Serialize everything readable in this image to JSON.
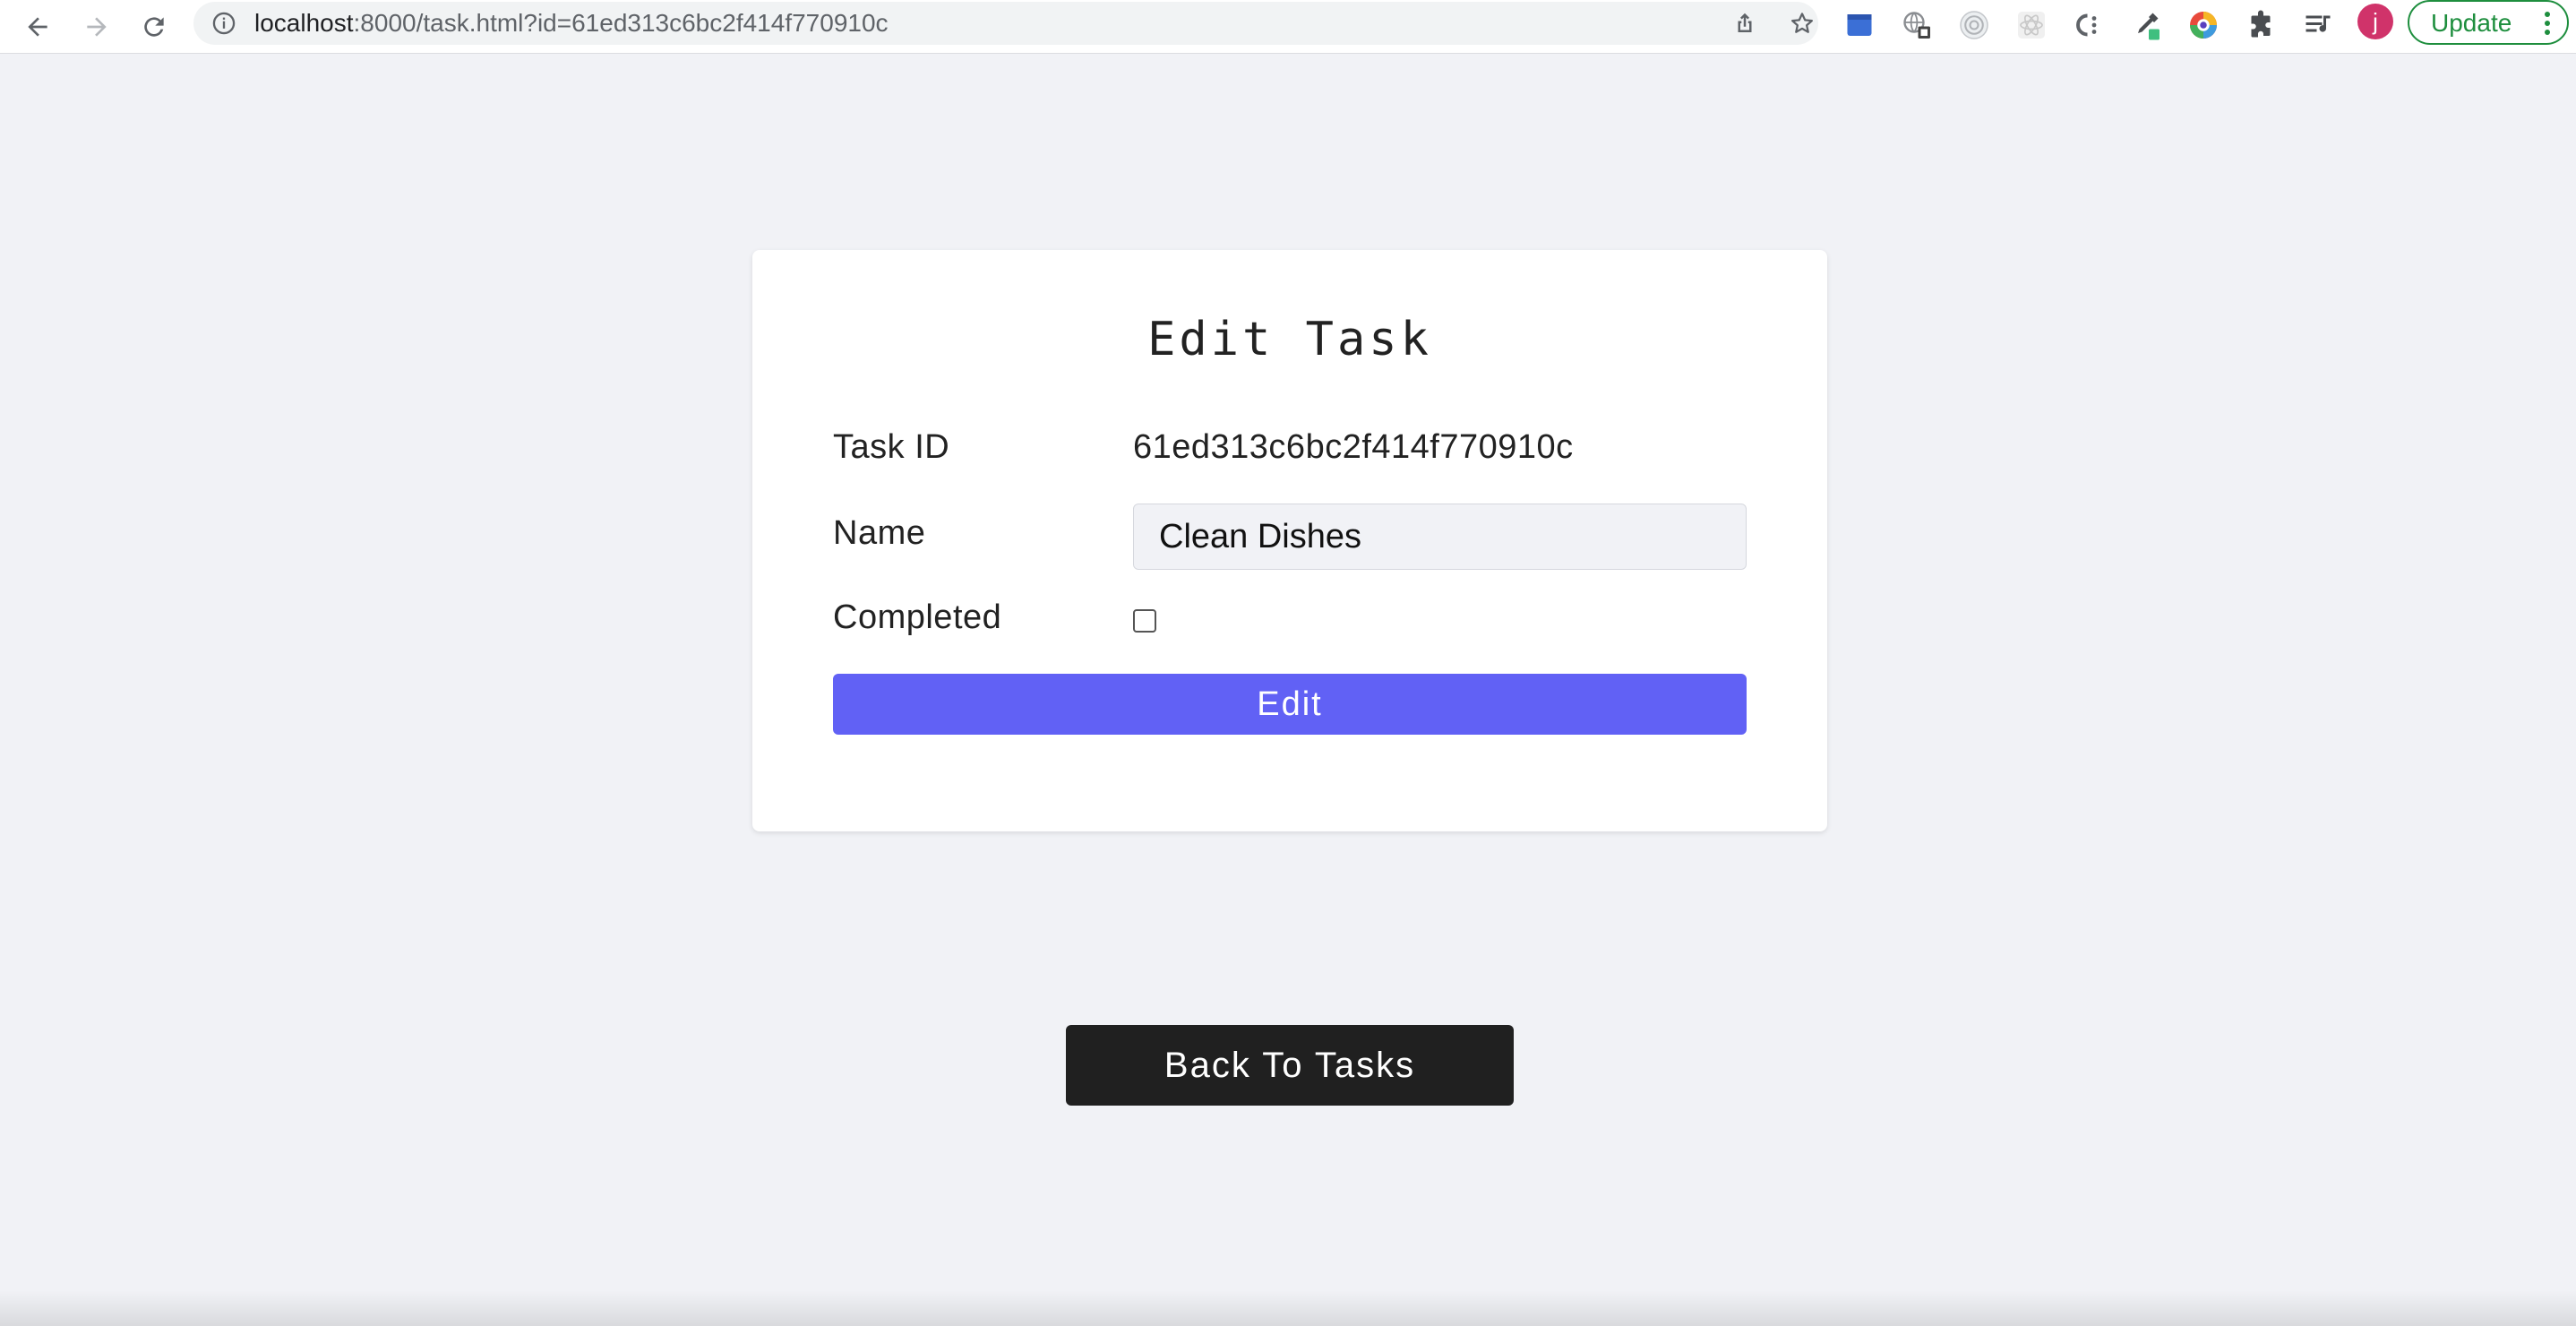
{
  "browser": {
    "url_host": "localhost",
    "url_rest": ":8000/task.html?id=61ed313c6bc2f414f770910c",
    "avatar_letter": "j",
    "update_label": "Update"
  },
  "icons": {
    "back": "back-arrow-icon",
    "forward": "forward-arrow-icon",
    "reload": "reload-icon",
    "info": "info-icon",
    "share": "share-icon",
    "bookmark": "star-icon",
    "extensions": [
      "calendar-extension-icon",
      "translate-extension-icon",
      "radar-extension-icon",
      "react-extension-icon",
      "css-extension-icon",
      "eyedropper-extension-icon",
      "color-wheel-extension-icon",
      "puzzle-icon",
      "reading-list-icon"
    ]
  },
  "colors": {
    "page_bg": "#f1f2f6",
    "edit_button": "#6161f5",
    "back_button": "#202020",
    "update_green": "#1e8e3e",
    "avatar": "#d0336a"
  },
  "card": {
    "title": "Edit Task",
    "task_id_label": "Task ID",
    "task_id_value": "61ed313c6bc2f414f770910c",
    "name_label": "Name",
    "name_value": "Clean Dishes",
    "completed_label": "Completed",
    "completed": false,
    "edit_label": "Edit"
  },
  "back_label": "Back To Tasks"
}
